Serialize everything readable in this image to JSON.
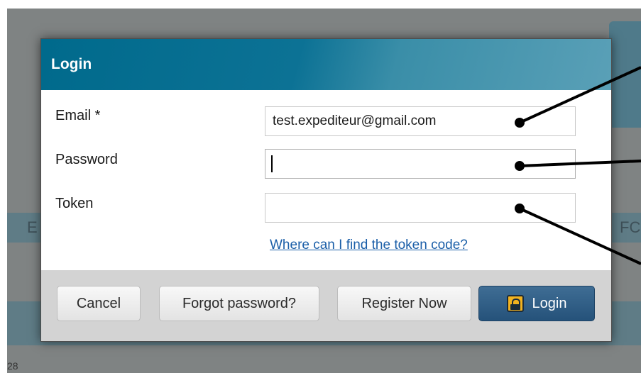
{
  "background": {
    "letter_left": "E",
    "letter_right": "FC",
    "footer_text": "28"
  },
  "dialog": {
    "title": "Login",
    "fields": {
      "email": {
        "label": "Email *",
        "value": "test.expediteur@gmail.com"
      },
      "password": {
        "label": "Password",
        "value": ""
      },
      "token": {
        "label": "Token",
        "value": ""
      }
    },
    "token_link": "Where can I find the token code?",
    "buttons": {
      "cancel": "Cancel",
      "forgot_password": "Forgot password?",
      "register_now": "Register Now",
      "login": "Login"
    }
  },
  "colors": {
    "header": "#006a8c",
    "primary_button": "#2f5f88",
    "link": "#1a5ea8",
    "lock_icon": "#f2b21f"
  },
  "icons": {
    "login_button_icon": "lock-icon"
  }
}
